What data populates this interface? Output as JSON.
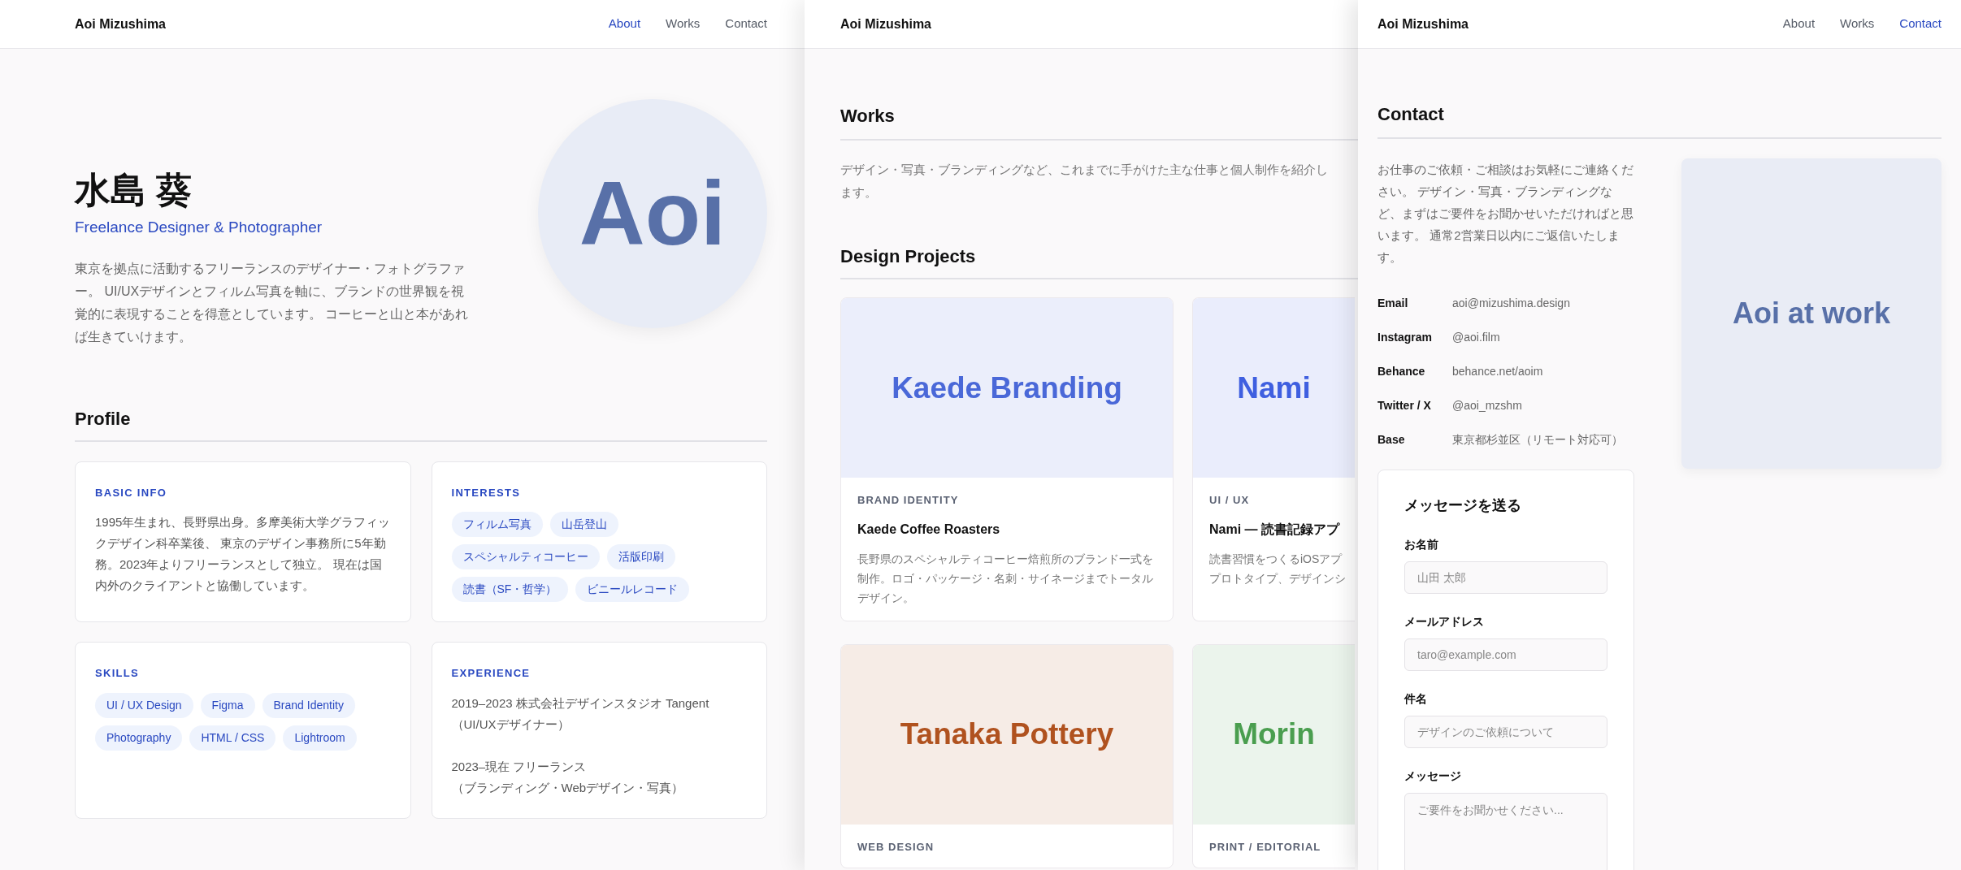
{
  "about_page": {
    "brand": "Aoi Mizushima",
    "nav": [
      {
        "label": "About",
        "selected": true
      },
      {
        "label": "Works",
        "selected": false
      },
      {
        "label": "Contact",
        "selected": false
      }
    ],
    "name": "水島 葵",
    "tagline": "Freelance Designer & Photographer",
    "bio": "東京を拠点に活動するフリーランスのデザイナー・フォトグラファー。 UI/UXデザインとフィルム写真を軸に、ブランドの世界観を視覚的に表現することを得意としています。 コーヒーと山と本があれば生きていけます。",
    "avatar_text": "Aoi",
    "profile_heading": "Profile",
    "cards": [
      {
        "kind": "text",
        "title": "BASIC INFO",
        "text": "1995年生まれ、長野県出身。多摩美術大学グラフィックデザイン科卒業後、 東京のデザイン事務所に5年勤務。2023年よりフリーランスとして独立。 現在は国内外のクライアントと協働しています。"
      },
      {
        "kind": "tags",
        "title": "INTERESTS",
        "tags": [
          "フィルム写真",
          "山岳登山",
          "スペシャルティコーヒー",
          "活版印刷",
          "読書（SF・哲学）",
          "ビニールレコード"
        ]
      },
      {
        "kind": "tags",
        "title": "SKILLS",
        "tags": [
          "UI / UX Design",
          "Figma",
          "Brand Identity",
          "Photography",
          "HTML / CSS",
          "Lightroom"
        ]
      },
      {
        "kind": "entries",
        "title": "EXPERIENCE",
        "entries": [
          [
            "2019–2023 株式会社デザインスタジオ Tangent",
            "（UI/UXデザイナー）"
          ],
          [
            "2023–現在 フリーランス",
            "（ブランディング・Webデザイン・写真）"
          ]
        ]
      }
    ]
  },
  "works_page": {
    "brand": "Aoi Mizushima",
    "heading": "Works",
    "intro": "デザイン・写真・ブランディングなど、これまでに手がけた主な仕事と個人制作を紹介します。",
    "section": "Design Projects",
    "projects": [
      {
        "thumb_text": "Kaede Branding",
        "color": "#4a68d8",
        "category": "BRAND IDENTITY",
        "title": "Kaede Coffee Roasters",
        "description": "長野県のスペシャルティコーヒー焙煎所のブランド一式を制作。ロゴ・パッケージ・名刺・サイネージまでトータルデザイン。"
      },
      {
        "thumb_text": "Nami",
        "color": "#3f5fe0",
        "category": "UI / UX",
        "title": "Nami — 読書記録アプ",
        "description_lines": [
          "読書習慣をつくるiOSアプ",
          "プロトタイプ、デザインシ"
        ]
      },
      {
        "thumb_text": "Tanaka Pottery",
        "color": "#b0521f",
        "category": "WEB DESIGN"
      },
      {
        "thumb_text": "Morin",
        "color": "#4a9e4f",
        "category": "PRINT / EDITORIAL"
      }
    ]
  },
  "contact_page": {
    "brand": "Aoi Mizushima",
    "nav": [
      {
        "label": "About",
        "selected": false
      },
      {
        "label": "Works",
        "selected": false
      },
      {
        "label": "Contact",
        "selected": true
      }
    ],
    "heading": "Contact",
    "intro": "お仕事のご依頼・ご相談はお気軽にご連絡ください。 デザイン・写真・ブランディングなど、まずはご要件をお聞かせいただければと思います。 通常2営業日以内にご返信いたします。",
    "details": [
      {
        "label": "Email",
        "value": "aoi@mizushima.design"
      },
      {
        "label": "Instagram",
        "value": "@aoi.film"
      },
      {
        "label": "Behance",
        "value": "behance.net/aoim"
      },
      {
        "label": "Twitter / X",
        "value": "@aoi_mzshm"
      },
      {
        "label": "Base",
        "value": "東京都杉並区（リモート対応可）"
      }
    ],
    "image_text": "Aoi at work",
    "form": {
      "title": "メッセージを送る",
      "fields": [
        {
          "kind": "input",
          "label": "お名前",
          "placeholder": "山田 太郎"
        },
        {
          "kind": "input",
          "label": "メールアドレス",
          "placeholder": "taro@example.com"
        },
        {
          "kind": "input",
          "label": "件名",
          "placeholder": "デザインのご依頼について"
        },
        {
          "kind": "textarea",
          "label": "メッセージ",
          "placeholder": "ご要件をお聞かせください..."
        }
      ]
    }
  }
}
